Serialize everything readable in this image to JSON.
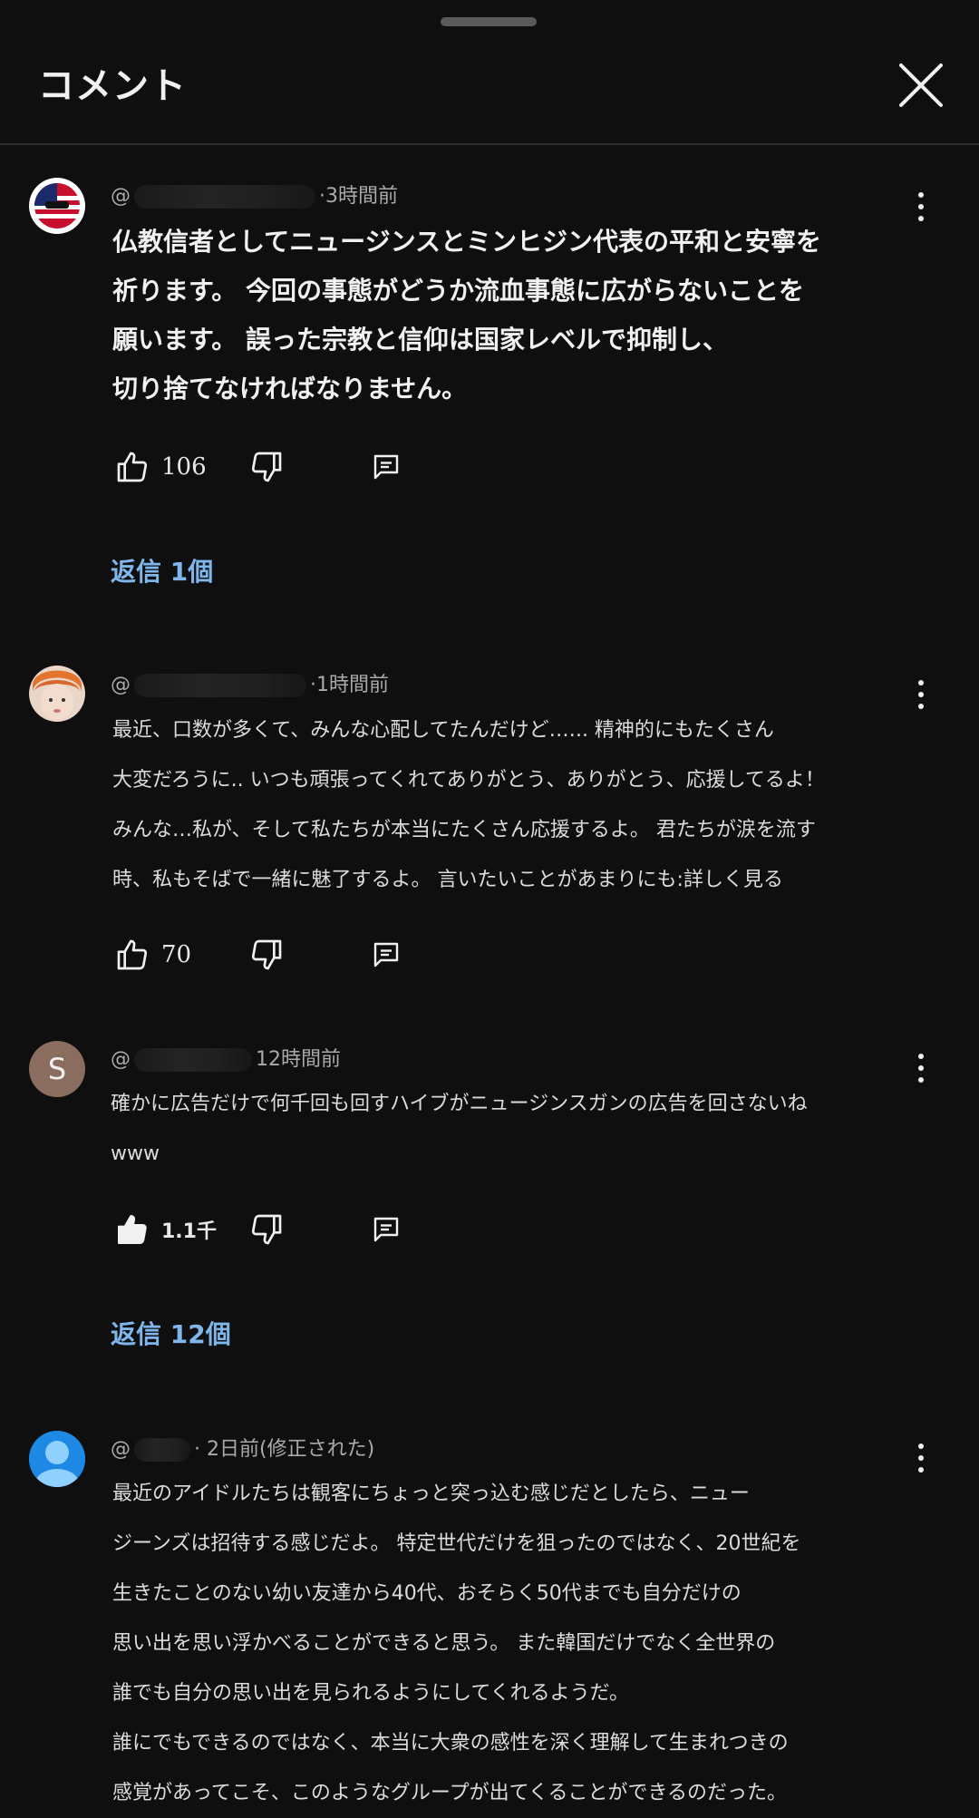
{
  "header": {
    "title": "コメント"
  },
  "comments": [
    {
      "handle": "@",
      "time": "·3時間前",
      "lines": [
        "仏教信者としてニュージンスとミンヒジン代表の平和と安寧を",
        "祈ります。 今回の事態がどうか流血事態に広がらないことを",
        "願います。 誤った宗教と信仰は国家レベルで抑制し、",
        "切り捨てなければなりません。"
      ],
      "likes": "106",
      "replies": "返信 1個"
    },
    {
      "handle": "@",
      "time": "·1時間前",
      "lines": [
        "最近、口数が多くて、みんな心配してたんだけど‥‥.. 精神的にもたくさん",
        "大変だろうに.. いつも頑張ってくれてありがとう、ありがとう、応援してるよ！",
        "みんな…私が、そして私たちが本当にたくさん応援するよ。 君たちが涙を流す",
        "時、私もそばで一緒に魅了するよ。 言いたいことがあまりにも:詳しく見る"
      ],
      "likes": "70"
    },
    {
      "handle": "@",
      "time": "12時間前",
      "avatar_letter": "S",
      "lines": [
        "確かに広告だけで何千回も回すハイブがニュージンスガンの広告を回さないね",
        "www"
      ],
      "likes": "1.1千",
      "replies": "返信 12個"
    },
    {
      "handle": "@",
      "time": "· 2日前(修正された)",
      "lines": [
        "最近のアイドルたちは観客にちょっと突っ込む感じだとしたら、ニュー",
        "ジーンズは招待する感じだよ。 特定世代だけを狙ったのではなく、20世紀を",
        "生きたことのない幼い友達から40代、おそらく50代までも自分だけの",
        "思い出を思い浮かべることができると思う。 また韓国だけでなく全世界の",
        "誰でも自分の思い出を見られるようにしてくれるようだ。",
        "誰にでもできるのではなく、本当に大衆の感性を深く理解して生まれつきの",
        "感覚があってこそ、このようなグループが出てくることができるのだった。"
      ]
    }
  ],
  "colors": {
    "background": "#0f0f0f",
    "reply_link": "#7fb6ec",
    "secondary_text": "#aaaaaa"
  }
}
